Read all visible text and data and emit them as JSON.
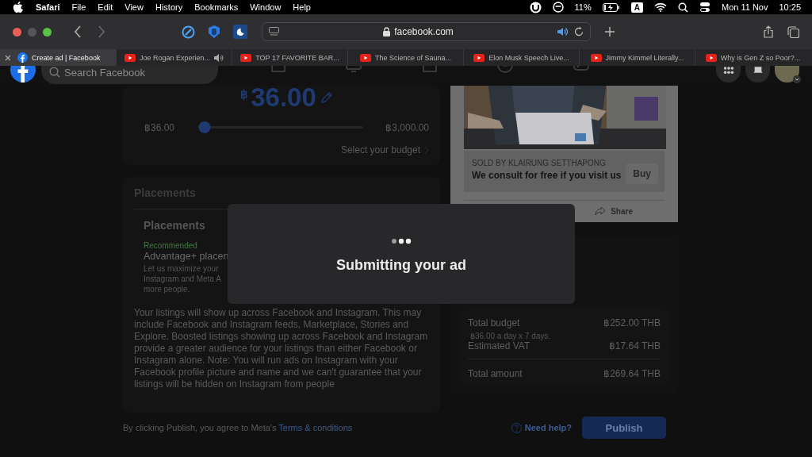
{
  "menubar": {
    "app": "Safari",
    "menus": [
      "File",
      "Edit",
      "View",
      "History",
      "Bookmarks",
      "Window",
      "Help"
    ],
    "battery": "11%",
    "input_source": "A",
    "date": "Mon 11 Nov",
    "time": "10:25"
  },
  "toolbar": {
    "address": "facebook.com"
  },
  "tabs": [
    {
      "title": "Create ad | Facebook",
      "kind": "facebook",
      "selected": true,
      "audio": false
    },
    {
      "title": "Joe Rogan Experien...",
      "kind": "youtube",
      "selected": false,
      "audio": true
    },
    {
      "title": "TOP 17 FAVORITE BAR...",
      "kind": "youtube",
      "selected": false,
      "audio": false
    },
    {
      "title": "The Science of Sauna...",
      "kind": "youtube",
      "selected": false,
      "audio": false
    },
    {
      "title": "Elon Musk Speech Live...",
      "kind": "youtube",
      "selected": false,
      "audio": false
    },
    {
      "title": "Jimmy Kimmel Literally...",
      "kind": "youtube",
      "selected": false,
      "audio": false
    },
    {
      "title": "Why is Gen Z so Poor?...",
      "kind": "youtube",
      "selected": false,
      "audio": false
    }
  ],
  "facebook_header": {
    "search_placeholder": "Search Facebook"
  },
  "budget": {
    "currency": "฿",
    "amount": "36.00",
    "min": "฿36.00",
    "max": "฿3,000.00",
    "level": 0,
    "link": "Select your budget"
  },
  "placements": {
    "title": "Placements",
    "subtitle": "Placements",
    "badge": "Recommended",
    "option": "Advantage+ placen",
    "description": [
      "Let us maximize your",
      "Instagram and Meta A",
      "more people."
    ]
  },
  "listing_note": "Your listings will show up across Facebook and Instagram. This may include Facebook and Instagram feeds, Marketplace, Stories and Explore. Boosted listings showing up across Facebook and Instagram provide a greater audience for your listings than either Facebook or Instagram alone. Note: You will run ads on Instagram with your Facebook profile picture and name and we can't guarantee that your listings will be hidden on Instagram from people",
  "ad_preview": {
    "seller": "SOLD BY KLAIRUNG SETTHAPONG",
    "headline": "We consult for free if you visit us",
    "button": "Buy",
    "action": "Share"
  },
  "summary": [
    {
      "kind": "line",
      "label": "Total budget",
      "value": "฿252.00 THB",
      "note": "฿36.00 a day x 7 days."
    },
    {
      "kind": "line",
      "label": "Estimated VAT",
      "value": "฿17.64 THB"
    },
    {
      "kind": "total",
      "label": "Total amount",
      "value": "฿269.64 THB"
    }
  ],
  "footer": {
    "agreement": "By clicking Publish, you agree to Meta's",
    "link": "Terms & conditions",
    "help": "Need help?",
    "publish": "Publish"
  },
  "modal": {
    "message": "Submitting your ad"
  }
}
